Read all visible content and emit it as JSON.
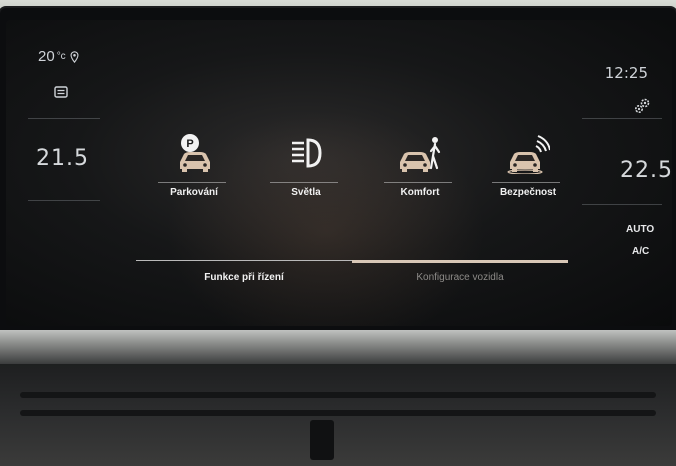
{
  "climate_left": {
    "outside_temp": "20",
    "outside_unit": "°c",
    "set_temp": "21.5"
  },
  "climate_right": {
    "time": "12:25",
    "set_temp": "22.5",
    "auto_label": "AUTO",
    "ac_label": "A/C"
  },
  "tiles": [
    {
      "label": "Parkování",
      "icon": "parking-car-icon"
    },
    {
      "label": "Světla",
      "icon": "headlight-icon"
    },
    {
      "label": "Komfort",
      "icon": "car-person-icon"
    },
    {
      "label": "Bezpečnost",
      "icon": "car-safety-icon"
    }
  ],
  "tabs": [
    {
      "label": "Funkce při řízení",
      "active": false
    },
    {
      "label": "Konfigurace vozidla",
      "active": true
    }
  ],
  "colors": {
    "tile_icon": "#d9c3ad",
    "active_tab_bar": "#d8c7b6",
    "inactive_tab_bar": "#b9b9b9",
    "inactive_tab_text": "#8d8b88"
  }
}
